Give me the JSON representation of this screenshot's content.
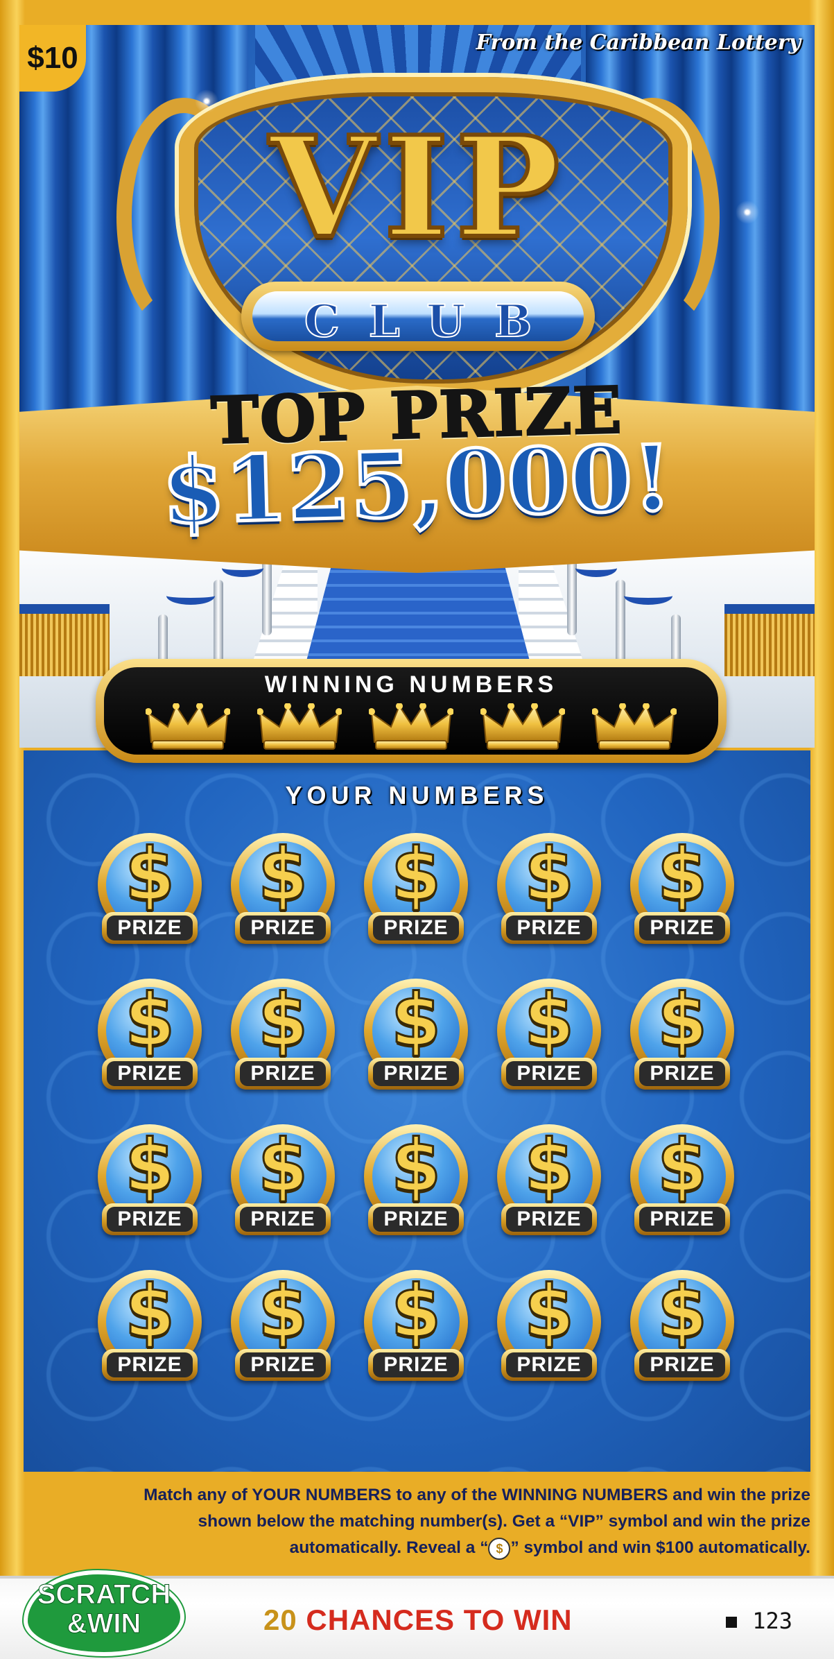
{
  "ticket": {
    "price": "$10",
    "publisher": "From the Caribbean Lottery",
    "title": "VIP",
    "subtitle": "CLUB",
    "top_prize_label": "TOP PRIZE",
    "top_prize_amount": "$125,000!",
    "winning_numbers_label": "WINNING NUMBERS",
    "winning_numbers_count": 5,
    "your_numbers_label": "YOUR NUMBERS",
    "spot_symbol": "$",
    "spot_prize_label": "PRIZE",
    "rules_text_1": "Match any of YOUR NUMBERS to any of the WINNING NUMBERS and win the prize",
    "rules_text_2": "shown below the matching number(s). Get a “VIP” symbol and win the prize",
    "rules_text_3a": "automatically. Reveal a “",
    "rules_text_3b": "” symbol and win $100 automatically.",
    "brand_logo": "SCRATCH & WIN",
    "chances_number": "20",
    "chances_text": "CHANCES TO WIN",
    "ticket_number": "123"
  },
  "colors": {
    "gold": "#e9ad26",
    "blue": "#2165c0",
    "red": "#d52b1e",
    "green": "#1f9a3d"
  },
  "icons": {
    "crown": "crown-icon",
    "coin": "dollar-coin-icon",
    "money_bag": "money-bag-icon"
  }
}
